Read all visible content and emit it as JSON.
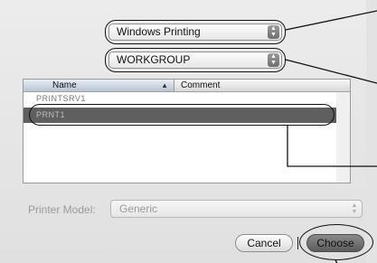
{
  "protocol_popup": {
    "value": "Windows Printing"
  },
  "workgroup_popup": {
    "value": "WORKGROUP"
  },
  "table": {
    "columns": [
      "Name",
      "Comment"
    ],
    "rows": [
      {
        "name": "PRINTSRV1"
      },
      {
        "name": "PRNT1"
      }
    ]
  },
  "printer_model": {
    "label": "Printer Model:",
    "value": "Generic"
  },
  "buttons": {
    "cancel": "Cancel",
    "choose": "Choose"
  }
}
